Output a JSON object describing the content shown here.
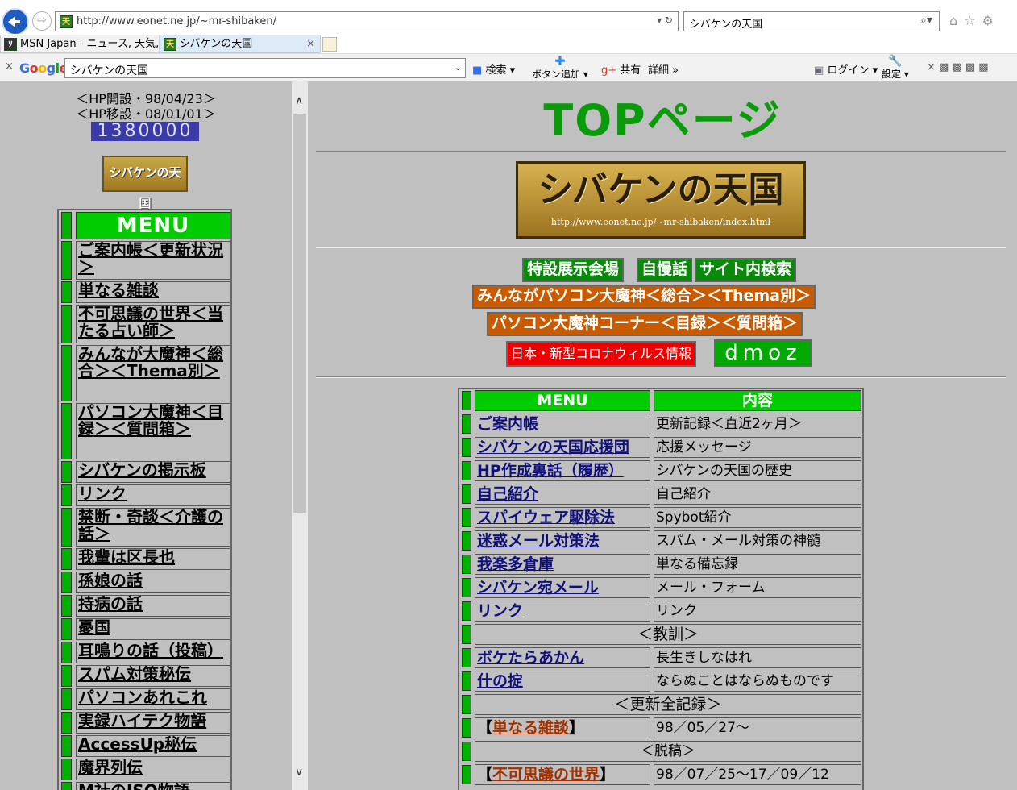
{
  "browser": {
    "url": "http://www.eonet.ne.jp/~mr-shibaken/",
    "search_value": "シバケンの天国",
    "tabs": [
      {
        "label": "MSN Japan - ニュース, 天気,..."
      },
      {
        "label": "シバケンの天国"
      }
    ],
    "toolbar": {
      "google_label": "Google",
      "google_value": "シバケンの天国",
      "search_label": "検索",
      "add_button_label": "ボタン追加",
      "share_label": "共有",
      "more_label": "詳細",
      "login_label": "ログイン",
      "settings_label": "設定"
    }
  },
  "sidebar": {
    "opened": "＜HP開設・98/04/23＞",
    "moved": "＜HP移設・08/01/01＞",
    "counter": "1380000",
    "banner_label": "シバケンの天国",
    "menu_header": "MENU",
    "items": [
      {
        "label": "ご案内帳＜更新状況＞"
      },
      {
        "label": "単なる雑談"
      },
      {
        "label": "不可思議の世界＜当たる占い師＞"
      },
      {
        "label": "みんなが大魔神＜総合＞＜Thema別＞"
      },
      {
        "label": "パソコン大魔神＜目録＞＜質問箱＞"
      },
      {
        "label": "シバケンの掲示板"
      },
      {
        "label": "リンク"
      },
      {
        "label": "禁断・奇談＜介護の話＞"
      },
      {
        "label": "我輩は区長也"
      },
      {
        "label": "孫娘の話"
      },
      {
        "label": "持病の話"
      },
      {
        "label": "憂国"
      },
      {
        "label": "耳鳴りの話（投稿）"
      },
      {
        "label": "スパム対策秘伝"
      },
      {
        "label": "パソコンあれこれ"
      },
      {
        "label": "実録ハイテク物語"
      },
      {
        "label": "AccessUp秘伝"
      },
      {
        "label": "魔界列伝"
      },
      {
        "label": "M社のISO物語"
      }
    ]
  },
  "main": {
    "title": "TOPページ",
    "banner_title": "シバケンの天国",
    "banner_url": "http://www.eonet.ne.jp/~mr-shibaken/index.html",
    "nav": {
      "special": "特設展示会場",
      "boast": "自慢話",
      "site_search": "サイト内検索",
      "everyone": "みんながパソコン大魔神＜総合＞＜Thema別＞",
      "pc_corner": "パソコン大魔神コーナー＜目録＞＜質問箱＞",
      "corona": "日本・新型コロナウィルス情報",
      "dmoz": "dmoz"
    },
    "table": {
      "col_menu": "MENU",
      "col_content": "内容",
      "rows": [
        {
          "menu": "ご案内帳",
          "content": "更新記録＜直近2ヶ月＞"
        },
        {
          "menu": "シバケンの天国応援団",
          "content": "応援メッセージ"
        },
        {
          "menu": "HP作成裏話（履歴）",
          "content": "シバケンの天国の歴史"
        },
        {
          "menu": "自己紹介",
          "content": "自己紹介"
        },
        {
          "menu": "スパイウェア駆除法",
          "content": "Spybot紹介"
        },
        {
          "menu": "迷惑メール対策法",
          "content": "スパム・メール対策の神髄"
        },
        {
          "menu": "我楽多倉庫",
          "content": "単なる備忘録"
        },
        {
          "menu": "シバケン宛メール",
          "content": "メール・フォーム"
        },
        {
          "menu": "リンク",
          "content": "リンク"
        }
      ],
      "section_lesson": "＜教訓＞",
      "lesson_rows": [
        {
          "menu": "ボケたらあかん",
          "content": "長生きしなはれ"
        },
        {
          "menu": "什の掟",
          "content": "ならぬことはならぬものです"
        }
      ],
      "section_all": "＜更新全記録＞",
      "all_rows": [
        {
          "menu_pre": "【",
          "menu": "単なる雑談",
          "menu_post": "】",
          "content": "98／05／27～"
        }
      ],
      "section_draft": "＜脱稿＞",
      "draft_rows": [
        {
          "menu_pre": "【",
          "menu": "不可思議の世界",
          "menu_post": "】",
          "content": "98／07／25～17／09／12"
        }
      ]
    }
  }
}
